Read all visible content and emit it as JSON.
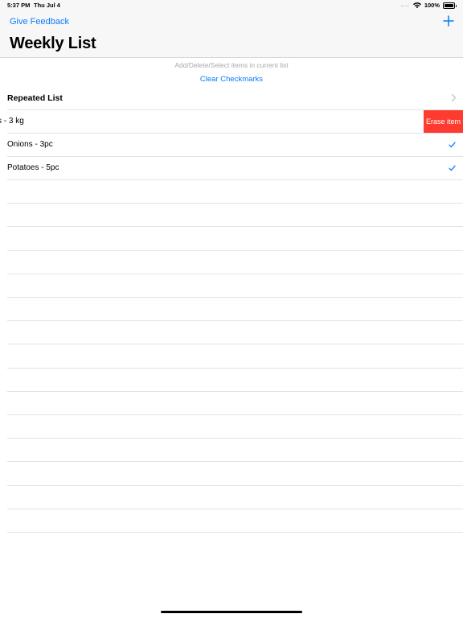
{
  "status_bar": {
    "time": "5:37 PM",
    "date": "Thu Jul 4",
    "signal_dots": "....",
    "battery": "100%"
  },
  "nav": {
    "feedback_label": "Give Feedback",
    "title": "Weekly List",
    "add_icon": "plus-icon"
  },
  "hint_text": "Add/Delete/Select items in current list",
  "clear_label": "Clear Checkmarks",
  "rows": [
    {
      "label": "Repeated List",
      "accessory": "chevron-right-icon"
    },
    {
      "label": "s - 3 kg",
      "action": "Erase item"
    },
    {
      "label": "Onions - 3pc",
      "checked": true
    },
    {
      "label": "Potatoes - 5pc",
      "checked": true
    }
  ],
  "colors": {
    "accent": "#0a7aff",
    "destructive": "#ff3b30",
    "separator": "#e3e3e6",
    "hint": "#a8a8ad"
  }
}
